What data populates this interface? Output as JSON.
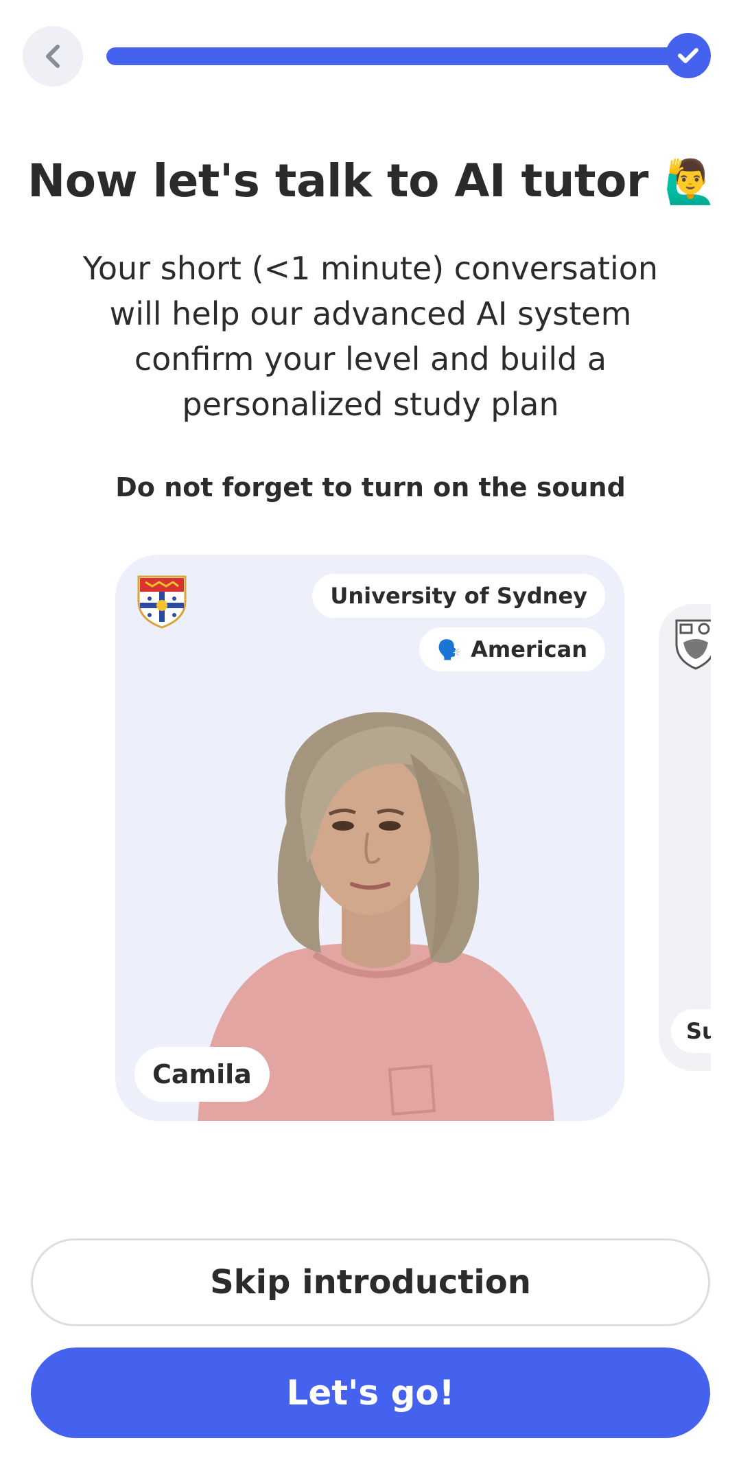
{
  "header": {
    "progress_percent": 100
  },
  "intro": {
    "title": "Now let's talk to AI tutor",
    "title_emoji": "🙋‍♂️",
    "description": "Your short (<1 minute) conversation will help our advanced AI system confirm your level and build a personalized study plan",
    "sound_note": "Do not forget to turn on the sound"
  },
  "tutor_cards": [
    {
      "name": "Camila",
      "university": "University of Sydney",
      "accent": "American",
      "accent_icon": "🗣️"
    },
    {
      "name_partial": "Su"
    }
  ],
  "actions": {
    "skip_label": "Skip introduction",
    "go_label": "Let's go!"
  },
  "colors": {
    "accent": "#4562ef",
    "card_background": "#edf0fa"
  }
}
